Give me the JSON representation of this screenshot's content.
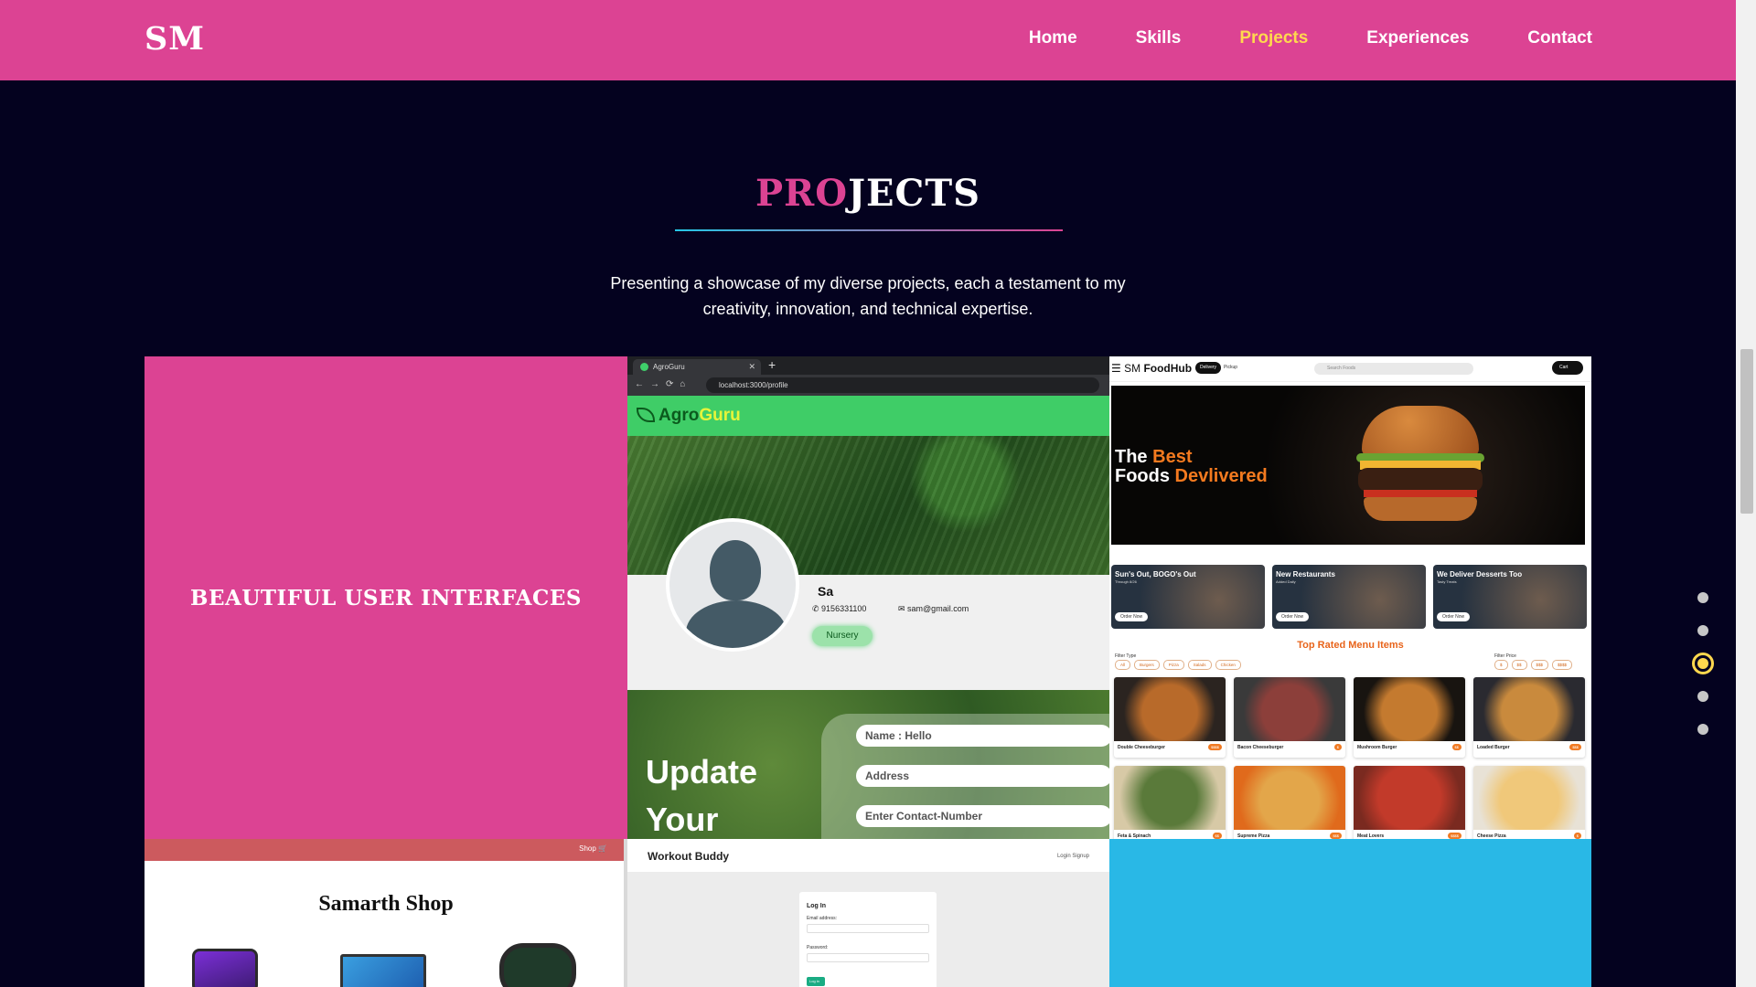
{
  "nav": {
    "logo": "SM",
    "links": [
      "Home",
      "Skills",
      "Projects",
      "Experiences",
      "Contact"
    ],
    "active": "Projects"
  },
  "section": {
    "title_accent": "PRO",
    "title_rest": "JECTS",
    "subtitle": "Presenting a showcase of my diverse projects, each a testament to my creativity, innovation, and technical expertise."
  },
  "dot_nav": {
    "count": 5,
    "active_index": 2
  },
  "projects": {
    "card1": {
      "label": "BEAUTIFUL USER INTERFACES",
      "color": "#dc4393"
    },
    "agroguru": {
      "tab_title": "AgroGuru",
      "url": "localhost:3000/profile",
      "brand_part1": "Agro",
      "brand_part2": "Guru",
      "profile_name": "Sa",
      "phone": "9156331100",
      "email": "sam@gmail.com",
      "badge": "Nursery",
      "update_heading": "Update Your",
      "inputs": [
        "Name : Hello",
        "Address",
        "Enter Contact-Number"
      ]
    },
    "foodhub": {
      "logo_prefix": "SM",
      "logo_name": "FoodHub",
      "delivery": "Delivery",
      "pickup": "Pickup",
      "search_placeholder": "Search Foods",
      "cart": "Cart",
      "hero_line1_a": "The ",
      "hero_line1_b": "Best",
      "hero_line2_a": "Foods ",
      "hero_line2_b": "Devlivered",
      "promos": [
        {
          "title": "Sun's Out, BOGO's Out",
          "sub": "Through 8/26",
          "button": "Order Now"
        },
        {
          "title": "New Restaurants",
          "sub": "Added Daily",
          "button": "Order Now"
        },
        {
          "title": "We Deliver Desserts Too",
          "sub": "Tasty Treats",
          "button": "Order Now"
        }
      ],
      "rated_title": "Top Rated Menu Items",
      "filter_type_label": "Filter Type",
      "filter_types": [
        "All",
        "Burgers",
        "Pizza",
        "Salads",
        "Chicken"
      ],
      "filter_price_label": "Filter Price",
      "filter_prices": [
        "$",
        "$$",
        "$$$",
        "$$$$"
      ],
      "items": [
        {
          "name": "Double Cheeseburger",
          "price": "$$$$"
        },
        {
          "name": "Bacon Cheeseburger",
          "price": "$"
        },
        {
          "name": "Mushroom Burger",
          "price": "$$"
        },
        {
          "name": "Loaded Burger",
          "price": "$$$"
        },
        {
          "name": "Feta & Spinach",
          "price": "$$"
        },
        {
          "name": "Supreme Pizza",
          "price": "$$$"
        },
        {
          "name": "Meat Lovers",
          "price": "$$$$"
        },
        {
          "name": "Cheese Pizza",
          "price": "$"
        }
      ]
    },
    "shop": {
      "nav_link": "Shop",
      "title": "Samarth Shop"
    },
    "workout": {
      "title": "Workout Buddy",
      "nav_right": "Login  Signup",
      "card_title": "Log In",
      "email_label": "Email address:",
      "password_label": "Password:",
      "button": "Log in"
    },
    "card6": {
      "color": "#29b8e6"
    }
  },
  "colors": {
    "brand_pink": "#dc4393",
    "active_yellow": "#ffd84e",
    "background": "#04021f"
  }
}
